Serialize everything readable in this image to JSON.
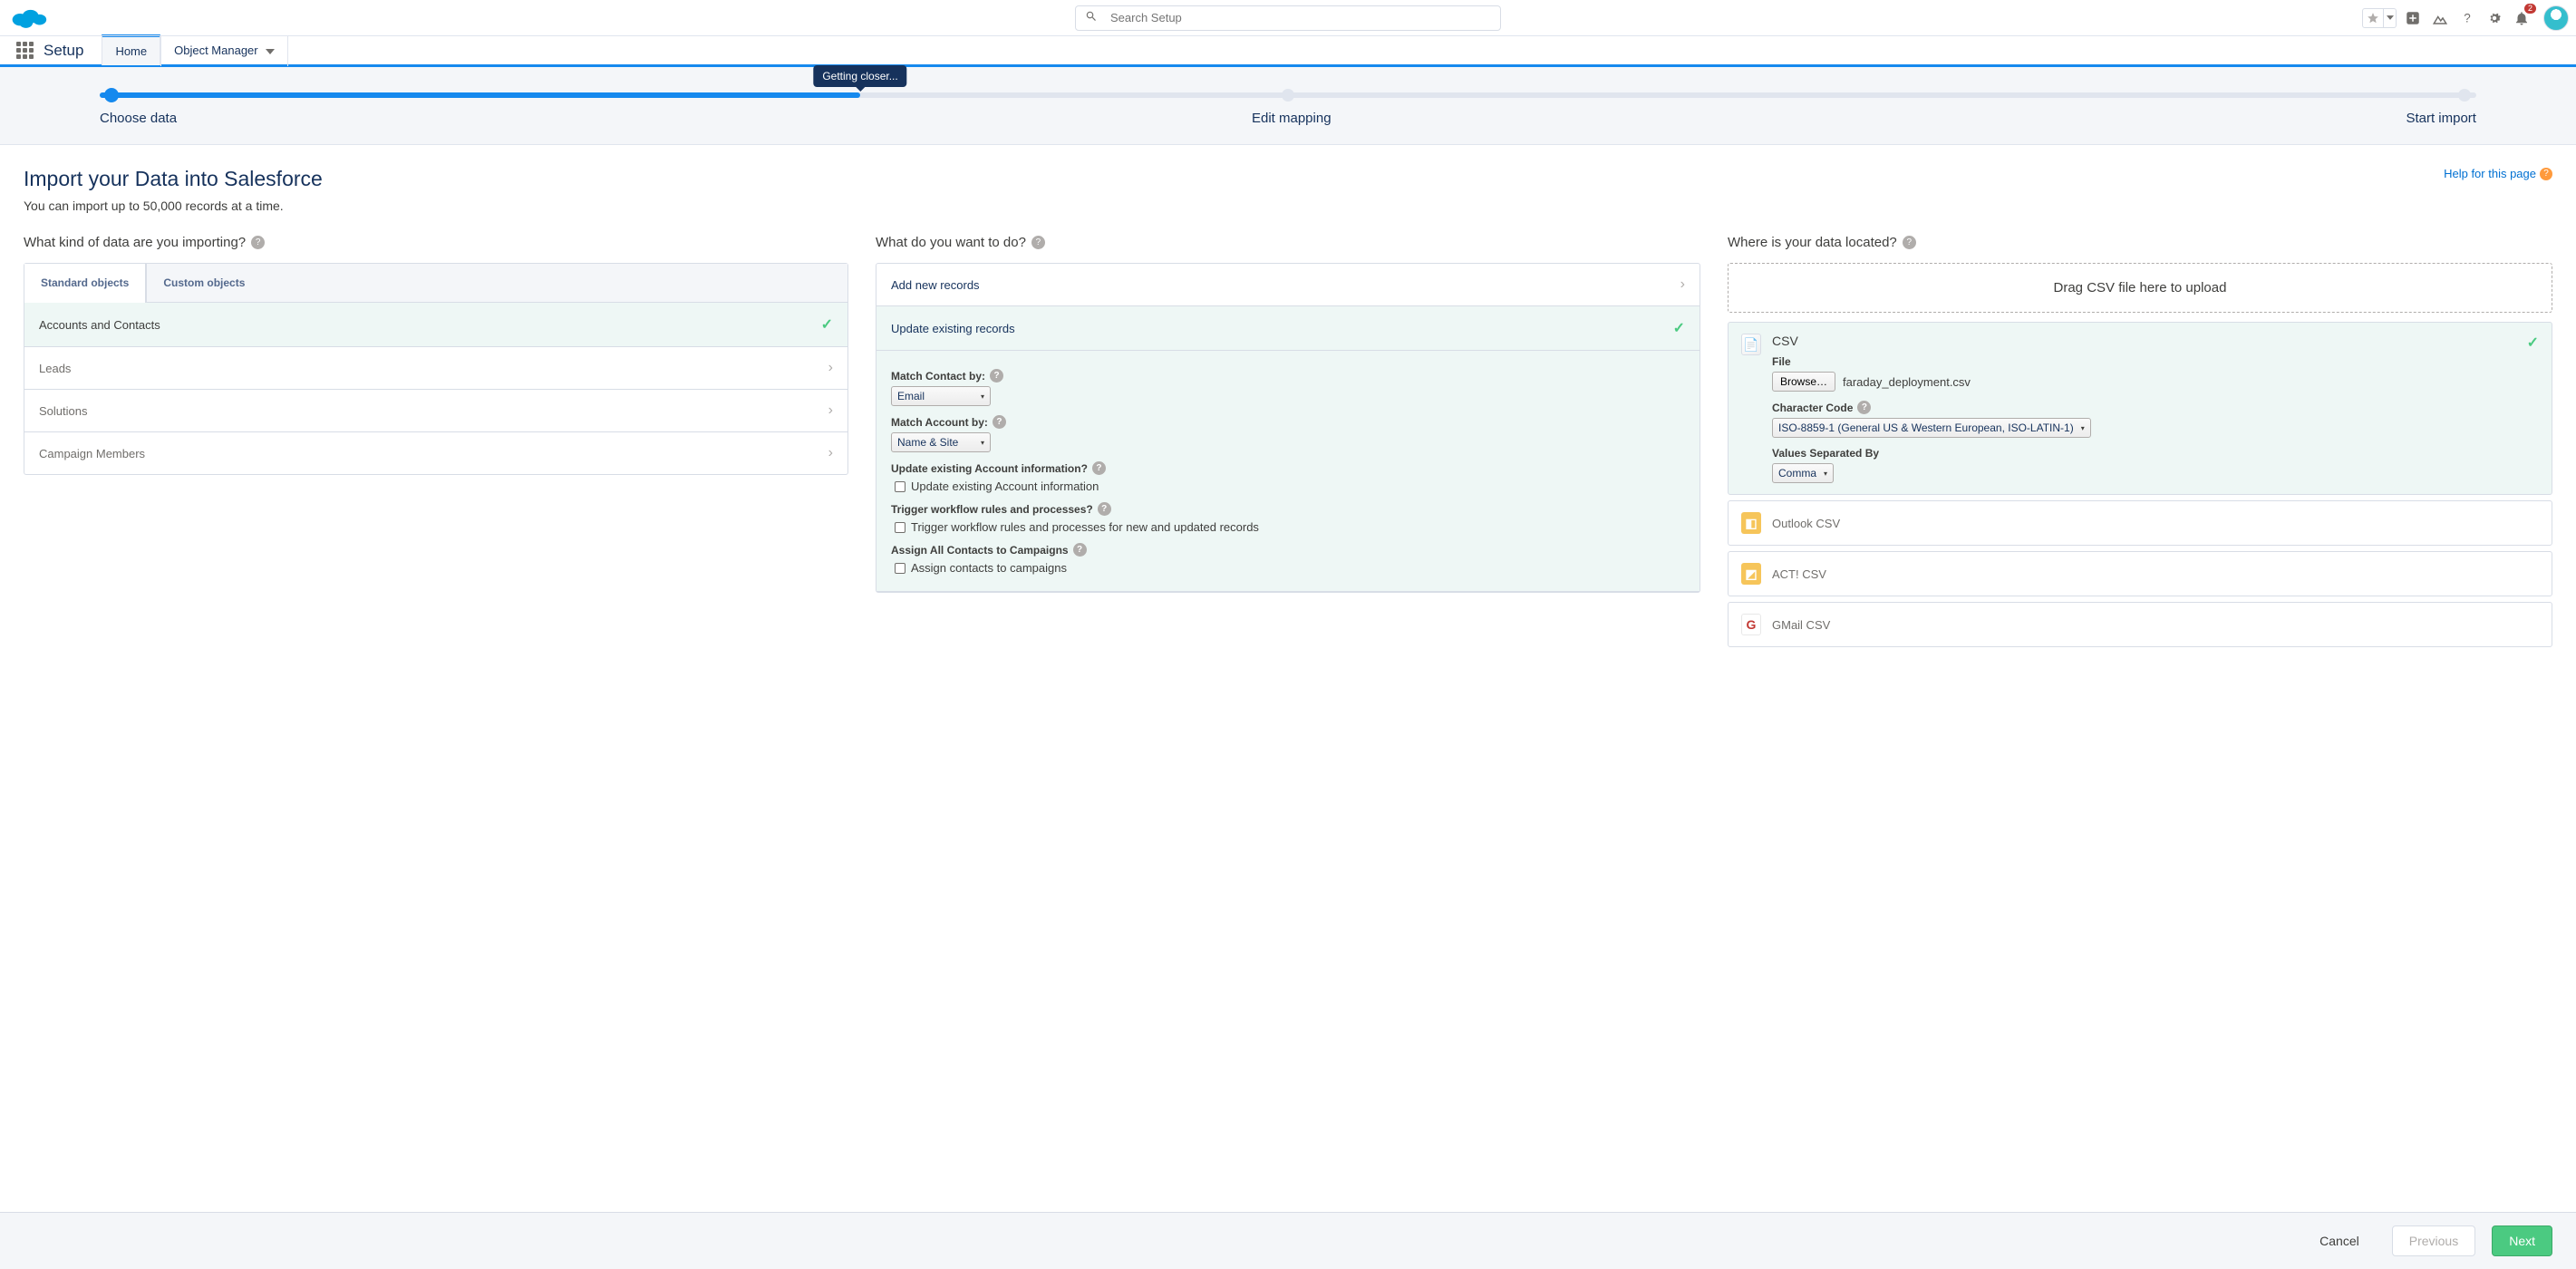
{
  "header": {
    "search_placeholder": "Search Setup",
    "badge_count": "2"
  },
  "context": {
    "app_name": "Setup",
    "tabs": [
      "Home",
      "Object Manager"
    ]
  },
  "progress": {
    "steps": [
      "Choose data",
      "Edit mapping",
      "Start import"
    ],
    "tooltip": "Getting closer..."
  },
  "page": {
    "title": "Import your Data into Salesforce",
    "subtitle": "You can import up to 50,000 records at a time.",
    "help_label": "Help for this page"
  },
  "col1": {
    "heading": "What kind of data are you importing?",
    "tabs": [
      "Standard objects",
      "Custom objects"
    ],
    "items": [
      "Accounts and Contacts",
      "Leads",
      "Solutions",
      "Campaign Members"
    ]
  },
  "col2": {
    "heading": "What do you want to do?",
    "add_label": "Add new records",
    "update_label": "Update existing records",
    "match_contact_label": "Match Contact by:",
    "match_contact_value": "Email",
    "match_account_label": "Match Account by:",
    "match_account_value": "Name & Site",
    "update_acct_label": "Update existing Account information?",
    "update_acct_chk": "Update existing Account information",
    "trigger_label": "Trigger workflow rules and processes?",
    "trigger_chk": "Trigger workflow rules and processes for new and updated records",
    "assign_label": "Assign All Contacts to Campaigns",
    "assign_chk": "Assign contacts to campaigns"
  },
  "col3": {
    "heading": "Where is your data located?",
    "drop_label": "Drag CSV file here to upload",
    "csv_title": "CSV",
    "file_label": "File",
    "browse_label": "Browse…",
    "filename": "faraday_deployment.csv",
    "charcode_label": "Character Code",
    "charcode_value": "ISO-8859-1 (General US & Western European, ISO-LATIN-1)",
    "sep_label": "Values Separated By",
    "sep_value": "Comma",
    "sources": [
      "Outlook CSV",
      "ACT! CSV",
      "GMail CSV"
    ]
  },
  "footer": {
    "cancel": "Cancel",
    "previous": "Previous",
    "next": "Next"
  }
}
